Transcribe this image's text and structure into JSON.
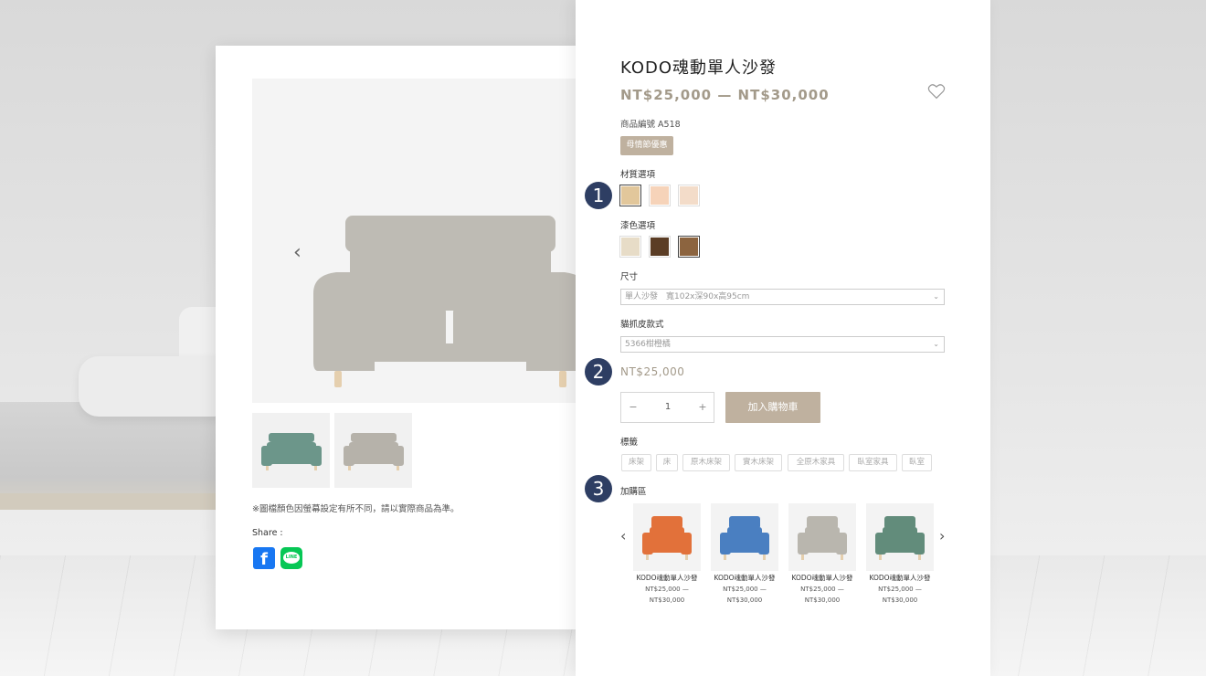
{
  "product": {
    "title": "KODO魂動單人沙發",
    "price_range": "NT$25,000 — NT$30,000",
    "sku": "商品編號 A518",
    "promo_badge": "母情節優惠"
  },
  "material": {
    "label": "材質選項",
    "swatches": [
      {
        "color": "#e2c79b",
        "selected": true
      },
      {
        "color": "#f6d3b9",
        "selected": false
      },
      {
        "color": "#f3dcc9",
        "selected": false
      }
    ]
  },
  "paint": {
    "label": "漆色選項",
    "swatches": [
      {
        "color": "#e7dcc7",
        "selected": false
      },
      {
        "color": "#5b3d25",
        "selected": false
      },
      {
        "color": "#8c643f",
        "selected": true
      }
    ]
  },
  "size": {
    "label": "尺寸",
    "selected": "單人沙發　寬102x深90x高95cm"
  },
  "leather": {
    "label": "貓抓皮款式",
    "selected": "5366柑橙橘"
  },
  "unit_price": "NT$25,000",
  "quantity": {
    "minus": "−",
    "value": "1",
    "plus": "+"
  },
  "add_to_cart": "加入購物車",
  "tags": {
    "label": "標籤",
    "items": [
      "床架",
      "床",
      "原木床架",
      "實木床架",
      "全原木家具",
      "臥室家具",
      "臥室"
    ]
  },
  "addon": {
    "label": "加購區",
    "items": [
      {
        "name": "KODO魂動單人沙發",
        "price_line1": "NT$25,000 —",
        "price_line2": "NT$30,000",
        "color": "#e2713a"
      },
      {
        "name": "KODO魂動單人沙發",
        "price_line1": "NT$25,000 —",
        "price_line2": "NT$30,000",
        "color": "#4a7fc1"
      },
      {
        "name": "KODO魂動單人沙發",
        "price_line1": "NT$25,000 —",
        "price_line2": "NT$30,000",
        "color": "#b9b6ae"
      },
      {
        "name": "KODO魂動單人沙發",
        "price_line1": "NT$25,000 —",
        "price_line2": "NT$30,000",
        "color": "#628c7b"
      }
    ]
  },
  "steps": [
    "1",
    "2",
    "3"
  ],
  "gallery": {
    "thumb_colors": [
      "#6c968a",
      "#b6b2aa"
    ],
    "main_color": "#bebbb4",
    "prev_arrow": "‹",
    "next_arrow": "›"
  },
  "note": "※圖檔顏色因螢幕設定有所不同，請以實際商品為準。",
  "share": {
    "label": "Share :",
    "facebook_icon": "facebook-icon",
    "line_icon": "line-icon",
    "facebook_glyph": "f",
    "line_glyph": "LINE"
  },
  "icons": {
    "heart": "heart-icon",
    "chevron": "⌄",
    "prev": "‹",
    "next": "›"
  }
}
